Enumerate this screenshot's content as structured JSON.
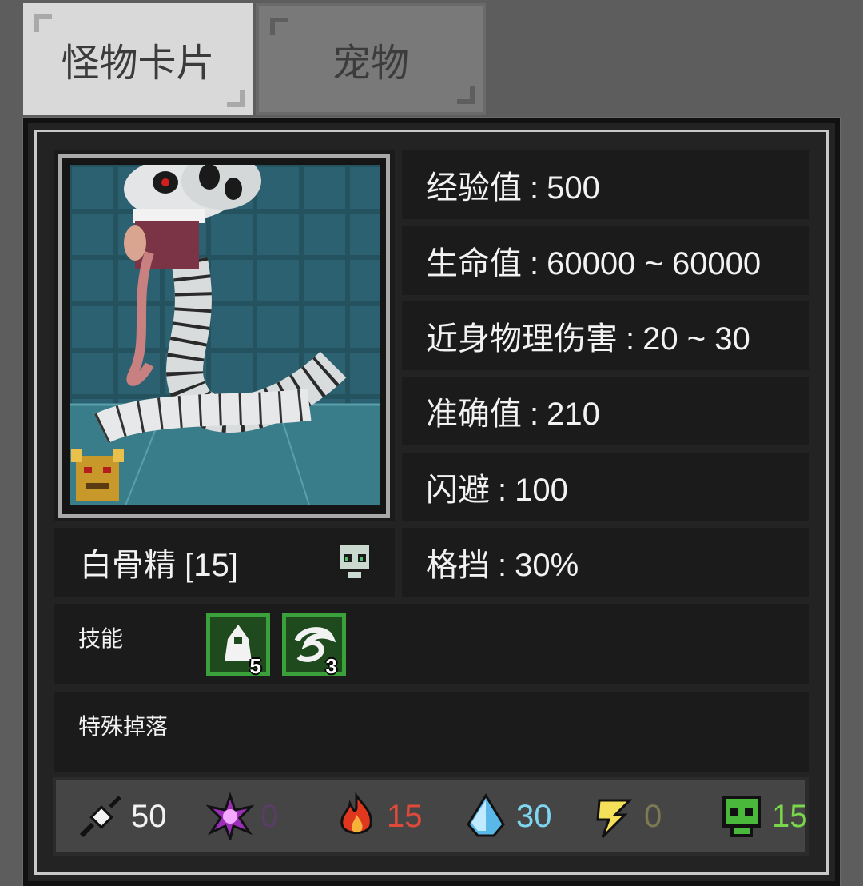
{
  "tabs": [
    {
      "label": "怪物卡片",
      "active": true
    },
    {
      "label": "宠物",
      "active": false
    }
  ],
  "stats": [
    {
      "label": "经验值",
      "value": "500"
    },
    {
      "label": "生命值",
      "value": "60000 ~ 60000"
    },
    {
      "label": "近身物理伤害",
      "value": "20 ~ 30"
    },
    {
      "label": "准确值",
      "value": "210"
    },
    {
      "label": "闪避",
      "value": "100"
    },
    {
      "label": "格挡",
      "value": "30%"
    }
  ],
  "stat_separator": ":",
  "monster": {
    "name": "白骨精 [15]",
    "type_icon": "skull-icon",
    "badge_icon": "gold-demon-badge-icon"
  },
  "skills": {
    "label": "技能",
    "items": [
      {
        "icon": "hooded-figure-icon",
        "level": "5"
      },
      {
        "icon": "swirl-icon",
        "level": "3"
      }
    ]
  },
  "drops": {
    "label": "特殊掉落"
  },
  "resistances": [
    {
      "icon": "sword-icon",
      "value": "50",
      "color": "#f2f2f2"
    },
    {
      "icon": "arcane-burst-icon",
      "value": "0",
      "color": "#5a3d66"
    },
    {
      "icon": "fire-icon",
      "value": "15",
      "color": "#e04a3a"
    },
    {
      "icon": "ice-crystal-icon",
      "value": "30",
      "color": "#7fd6f0"
    },
    {
      "icon": "lightning-icon",
      "value": "0",
      "color": "#7a7a55"
    },
    {
      "icon": "poison-skull-icon",
      "value": "15",
      "color": "#7ad64a"
    }
  ]
}
